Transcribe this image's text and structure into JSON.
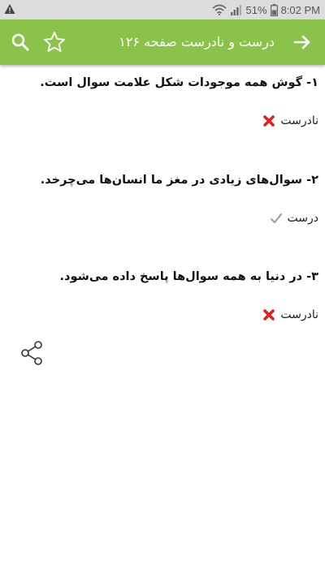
{
  "status_bar": {
    "battery": "51%",
    "time": "8:02 PM"
  },
  "app_bar": {
    "title": "درست و نادرست صفحه ۱۲۶"
  },
  "questions": [
    {
      "text": "۱- گوش همه موجودات شکل علامت سوال است.",
      "answer": "نادرست",
      "answer_icon": "cross-icon"
    },
    {
      "text": "۲- سوال‌های زیادی در مغز ما انسان‌ها می‌چرخد.",
      "answer": "درست",
      "answer_icon": "check-icon"
    },
    {
      "text": "۳- در دنیا به همه سوال‌ها پاسخ داده می‌شود.",
      "answer": "نادرست",
      "answer_icon": "cross-icon"
    }
  ],
  "colors": {
    "app_bar": "#8bc34a",
    "status_bar": "#dcdcdc",
    "cross": "#e02020"
  }
}
